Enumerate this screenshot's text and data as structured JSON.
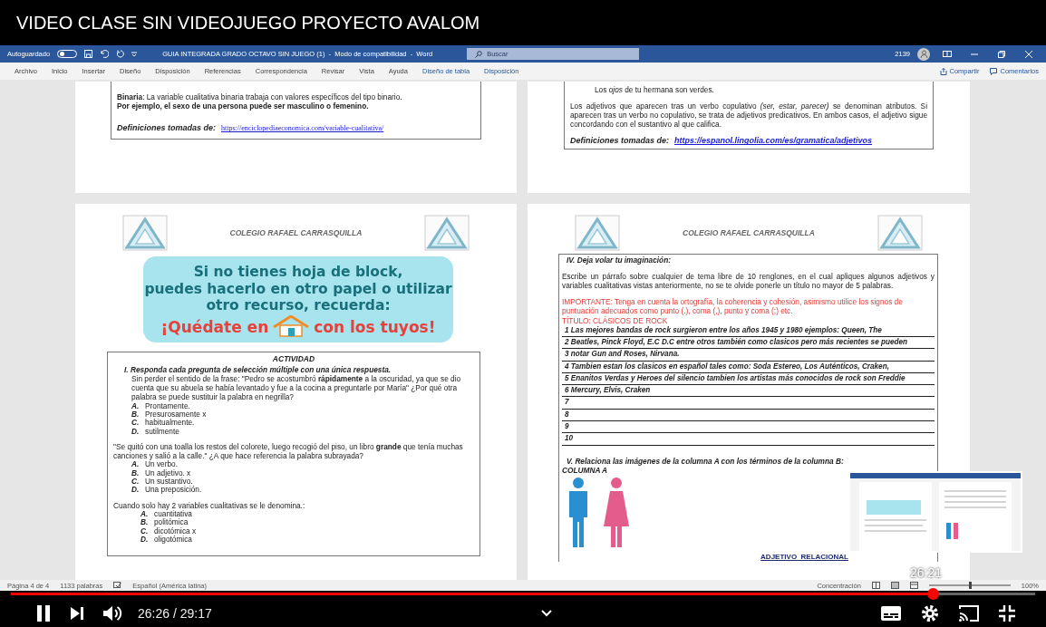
{
  "video_title": "VIDEO CLASE SIN VIDEOJUEGO PROYECTO AVALOM",
  "word": {
    "autosave": {
      "label": "Autoguardado",
      "on": false
    },
    "document_title": "GUIA INTEGRADA GRADO OCTAVO SIN JUEGO (1)  -  Modo de compatibilidad  -  Word",
    "search": {
      "placeholder": "Buscar"
    },
    "account_number": "2139"
  },
  "ribbon_tabs": [
    {
      "label": "Archivo",
      "kind": "standard"
    },
    {
      "label": "Inicio",
      "kind": "standard"
    },
    {
      "label": "Insertar",
      "kind": "standard"
    },
    {
      "label": "Diseño",
      "kind": "standard"
    },
    {
      "label": "Disposición",
      "kind": "standard"
    },
    {
      "label": "Referencias",
      "kind": "standard"
    },
    {
      "label": "Correspondencia",
      "kind": "standard"
    },
    {
      "label": "Revisar",
      "kind": "standard"
    },
    {
      "label": "Vista",
      "kind": "standard"
    },
    {
      "label": "Ayuda",
      "kind": "standard"
    },
    {
      "label": "Diseño de tabla",
      "kind": "contextual"
    },
    {
      "label": "Disposición",
      "kind": "contextual"
    }
  ],
  "ribbon_actions": {
    "share": "Compartir",
    "comments": "Comentarios"
  },
  "pages": {
    "top_left": {
      "paragraphs": [
        {
          "text": "**Binaria**: La variable cualitativa binaria trabaja con valores específicos del tipo binario.",
          "kind": "plain"
        },
        {
          "text": "Por ejemplo, el sexo de una persona puede ser masculino o femenino.",
          "kind": "bold"
        }
      ],
      "source": {
        "label": "Definiciones tomadas de:",
        "link": "https://enciclopediaeconomica.com/variable-cualitativa/"
      }
    },
    "top_right": {
      "example": "Los *ojos* de tu hermana son verdes.",
      "paragraph": "Los adjetivos que aparecen tras un verbo copulativo *(ser, estar, parecer)* se denominan atributos. Si aparecen tras un verbo no copulativo, se trata de adjetivos predicativos. En ambos casos, el adjetivo sigue concordando con el sustantivo al que califica.",
      "source": {
        "label": "Definiciones tomadas de:",
        "link": "https://espanol.lingolia.com/es/gramatica/adjetivos"
      }
    },
    "bottom_left": {
      "school": "COLEGIO RAFAEL CARRASQUILLA",
      "banner": {
        "lines": [
          "Si no tienes hoja de block,",
          "puedes hacerlo en otro papel o utilizar",
          "otro recurso, recuerda:"
        ],
        "slogan_start": "¡Quédate en",
        "slogan_end": "con los tuyos!"
      },
      "activity": {
        "title": "ACTIVIDAD",
        "section": "I.   Responda cada pregunta de selección múltiple con una única respuesta.",
        "questions": [
          {
            "text": "Sin perder el sentido de la frase: \"Pedro se acostumbró **rápidamente** a la oscuridad, ya que se dio cuenta que su abuela se había levantado y fue a la cocina a preguntarle por María\" ¿Por qué otra palabra se puede sustituir la palabra en negrilla?",
            "indent": true,
            "options": [
              {
                "letter": "A.",
                "text": "Prontamente."
              },
              {
                "letter": "B.",
                "text": "Presurosamente x"
              },
              {
                "letter": "C.",
                "text": "habitualmente."
              },
              {
                "letter": "D.",
                "text": "sutilmente"
              }
            ]
          },
          {
            "text": "\"Se quitó con una toalla los restos del colorete, luego recogió del piso, un libro **grande** que tenía muchas canciones y salió a la calle.\" ¿A que hace referencia la palabra subrayada?",
            "indent": false,
            "options": [
              {
                "letter": "A.",
                "text": "Un verbo."
              },
              {
                "letter": "B.",
                "text": "Un adjetivo. x"
              },
              {
                "letter": "C.",
                "text": "Un sustantivo."
              },
              {
                "letter": "D.",
                "text": "Una preposición."
              }
            ]
          },
          {
            "text": "Cuando solo hay 2 variables cualitativas se le denomina.:",
            "indent": false,
            "options": [
              {
                "letter": "A.",
                "text": "cuantitativa"
              },
              {
                "letter": "B.",
                "text": "politómica"
              },
              {
                "letter": "C.",
                "text": "dicotómica x"
              },
              {
                "letter": "D.",
                "text": "oligotómica"
              }
            ]
          }
        ]
      }
    },
    "bottom_right": {
      "school": "COLEGIO RAFAEL CARRASQUILLA",
      "section_iv": "IV.   Deja volar tu imaginación:",
      "instructions": "Escribe un párrafo sobre cualquier de tema libre de 10 renglones, en el cual apliques algunos adjetivos y variables cualitativas vistas anteriormente, no se te olvide ponerle un título no mayor de 5 palabras.",
      "important": "IMPORTANTE: Tenga en cuenta la ortografía, la coherencia y cohesión, asimismo utilice los signos de puntuación adecuados como punto (.), coma (,), punto y coma (;) etc.",
      "essay_title": "TÍTULO:  CLÁSICOS DE ROCK",
      "lines": [
        "1 Las mejores bandas de rock surgieron entre los años 1945 y 1980 ejemplos: Queen, The",
        "2 Beatles, Pinck Floyd, E.C D.C entre otros también como clasicos pero más recientes se pueden",
        "3 notar Gun and Roses, Nirvana.",
        "4 Tambien estan los clasicos en español tales como: Soda Estereo, Los Auténticos, Craken,",
        "5 Enanitos Verdas y Heroes del silencio tambien los artistas más conocidos de rock son Freddie",
        "6 Mercury, Elvis, Craken",
        "7",
        "8",
        "9",
        "10"
      ],
      "section_v": "V.   Relaciona las imágenes de la columna A con los términos de la columna B:",
      "column_label": "COLUMNA A",
      "term": "ADJETIVO  RELACIONAL"
    }
  },
  "status_bar": {
    "page": "Página 4 de 4",
    "words": "1133 palabras",
    "language": "Español (América latina)",
    "focus": "Concentración",
    "zoom": {
      "level": 0.5,
      "reading": "100%"
    }
  },
  "player": {
    "progress": {
      "level": 0.9
    },
    "preview_time": "26:21",
    "time": "26:26 / 29:17"
  }
}
